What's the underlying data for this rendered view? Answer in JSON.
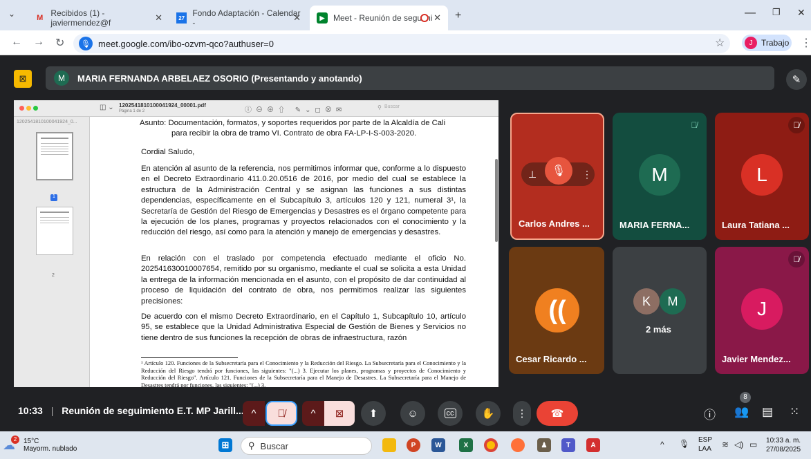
{
  "browser": {
    "tabs": [
      {
        "label": "Recibidos (1) - javiermendez@f",
        "icon": "gmail-icon"
      },
      {
        "label": "Fondo Adaptación - Calendar -",
        "icon": "calendar-icon"
      },
      {
        "label": "Meet - Reunión de seguimi",
        "icon": "meet-icon"
      }
    ],
    "url": "meet.google.com/ibo-ozvm-qco?authuser=0",
    "profile_label": "Trabajo",
    "profile_initial": "J"
  },
  "presenter": {
    "initial": "M",
    "name": "MARIA FERNANDA ARBELAEZ OSORIO (Presentando y anotando)"
  },
  "shared_doc": {
    "file_name": "1202541810100041924_00001.pdf",
    "page_info": "Página 1 de 2",
    "search_placeholder": "Buscar",
    "sidebar_title": "1202541810100041924_0...",
    "thumb_labels": [
      "1",
      "2"
    ],
    "asunto": "Asunto:  Documentación, formatos, y soportes requeridos por parte de la Alcaldía de Cali",
    "asunto_2": "para recibir la obra de tramo VI. Contrato de obra FA-LP-I-S-003-2020.",
    "saludo": "Cordial Saludo,",
    "p1": "En atención al asunto de la referencia, nos permitimos informar que, conforme a lo dispuesto en el Decreto Extraordinario 411.0.20.0516 de 2016, por medio del cual se establece la estructura de la Administración Central y se asignan las funciones a sus distintas dependencias, específicamente en el Subcapítulo 3, artículos 120 y 121, numeral 3¹, la Secretaría de Gestión del Riesgo de Emergencias y Desastres es el órgano competente para la ejecución de los planes, programas y proyectos relacionados con el conocimiento y la reducción del riesgo, así como para la atención y manejo de emergencias y desastres.",
    "p2": "En relación con el traslado por competencia efectuado mediante el oficio No. 202541630010007654, remitido por su organismo, mediante el cual se solicita a esta Unidad la entrega de la información mencionada en el asunto, con el propósito de dar continuidad al proceso de liquidación del contrato de obra, nos permitimos realizar las siguientes precisiones:",
    "p3": "De acuerdo con el mismo Decreto Extraordinario, en el Capítulo 1, Subcapítulo 10, artículo 95, se establece que la Unidad Administrativa Especial de Gestión de Bienes y Servicios no tiene dentro de sus funciones la recepción de obras de infraestructura, razón",
    "footnote": "¹ Artículo 120. Funciones de la Subsecretaría para el Conocimiento y la Reducción del Riesgo. La Subsecretaría para el Conocimiento y la Reducción del Riesgo tendrá por funciones, las siguientes: \"(...) 3. Ejecutar los planes, programas y proyectos de Conocimiento y Reducción del Riesgo\". Artículo 121. Funciones de la Subsecretaría para el Manejo de Desastres. La Subsecretaría para el Manejo de Desastres tendrá por funciones, las siguientes: \"(...) 3."
  },
  "participants": [
    {
      "name": "Carlos Andres ...",
      "initial": "",
      "color": "#b32d1f"
    },
    {
      "name": "MARIA FERNA...",
      "initial": "M",
      "color": "#134d3f",
      "avatar_color": "#1e6b52"
    },
    {
      "name": "Laura Tatiana ...",
      "initial": "L",
      "color": "#8e1c14",
      "avatar_color": "#d93025"
    },
    {
      "name": "Cesar Ricardo ...",
      "initial": "",
      "color": "#6b3a12"
    },
    {
      "name": "2 más",
      "initials": [
        "K",
        "M"
      ],
      "color": "#3c4043"
    },
    {
      "name": "Javier Mendez...",
      "initial": "J",
      "color": "#8a1848",
      "avatar_color": "#d81b60"
    }
  ],
  "controls": {
    "time": "10:33",
    "meeting_title": "Reunión de seguimiento E.T. MP Jarill...",
    "people_count": "8"
  },
  "taskbar": {
    "temp": "15°C",
    "weather": "Mayorm. nublado",
    "weather_badge": "2",
    "search_label": "Buscar",
    "lang": "ESP",
    "lang2": "LAA",
    "time": "10:33 a. m.",
    "date": "27/08/2025"
  }
}
